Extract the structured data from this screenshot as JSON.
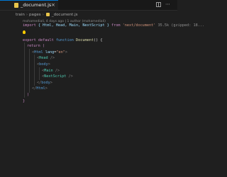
{
  "tab": {
    "label": "_document.js",
    "close": "×"
  },
  "breadcrumb": [
    "train",
    "pages",
    "_document.js"
  ],
  "codelens": "mohamediali, 4 days ago | 1 author (mohamediali)",
  "code": {
    "l1": {
      "kw": "import",
      "names": "{ Html, Head, Main, NextScript }",
      "from": "from",
      "mod": "'next/document'",
      "hint": "35.5k (gzipped: 18..."
    },
    "l3": {
      "export": "export",
      "default": "default",
      "function": "function",
      "name": "Document",
      "rest": "() {"
    },
    "l4": "return (",
    "l5": {
      "open": "<",
      "tag": "Html",
      "attr": "lang",
      "eq": "=",
      "val": "\"en\"",
      "close": ">"
    },
    "l6": {
      "open": "<",
      "tag": "Head",
      "close": " />"
    },
    "l7": {
      "open": "<",
      "tag": "body",
      "close": ">"
    },
    "l8": {
      "open": "<",
      "tag": "Main",
      "close": " />"
    },
    "l9": {
      "open": "<",
      "tag": "NextScript",
      "close": " />"
    },
    "l10": {
      "open": "</",
      "tag": "body",
      "close": ">"
    },
    "l11": {
      "open": "</",
      "tag": "Html",
      "close": ">"
    },
    "l12": ")",
    "l13": "}"
  }
}
